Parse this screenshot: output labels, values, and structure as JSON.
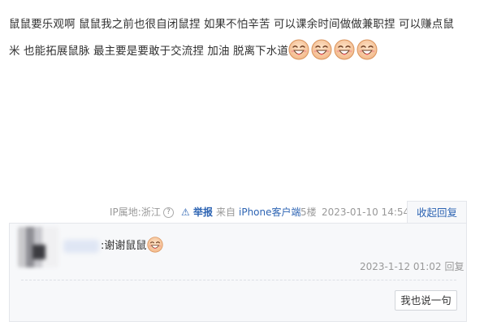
{
  "post": {
    "line1": "鼠鼠要乐观啊 鼠鼠我之前也很自闭鼠捏 如果不怕辛苦 可以课余时间做做兼职捏 可以赚点鼠",
    "line2": "米 也能拓展鼠脉 最主要是要敢于交流捏 加油 脱离下水道",
    "emoji_icon": "smiling-face-emoji",
    "emoji_count": 4
  },
  "meta": {
    "ip": "IP属地:浙江",
    "help_glyph": "?",
    "report_glyph": "⚠",
    "report": "举报",
    "from": "来自",
    "device": "iPhone客户端",
    "floor": "5楼",
    "date": "2023-01-10 14:54",
    "collapse": "收起回复"
  },
  "reply": {
    "text": ":谢谢鼠鼠",
    "time": "2023-1-12 01:02",
    "reply_label": "回复",
    "say_button": "我也说一句"
  },
  "colors": {
    "link": "#2d64b3",
    "muted": "#999999",
    "panel_bg": "#f7f8fa",
    "emoji_face": "#f8c9a0"
  }
}
